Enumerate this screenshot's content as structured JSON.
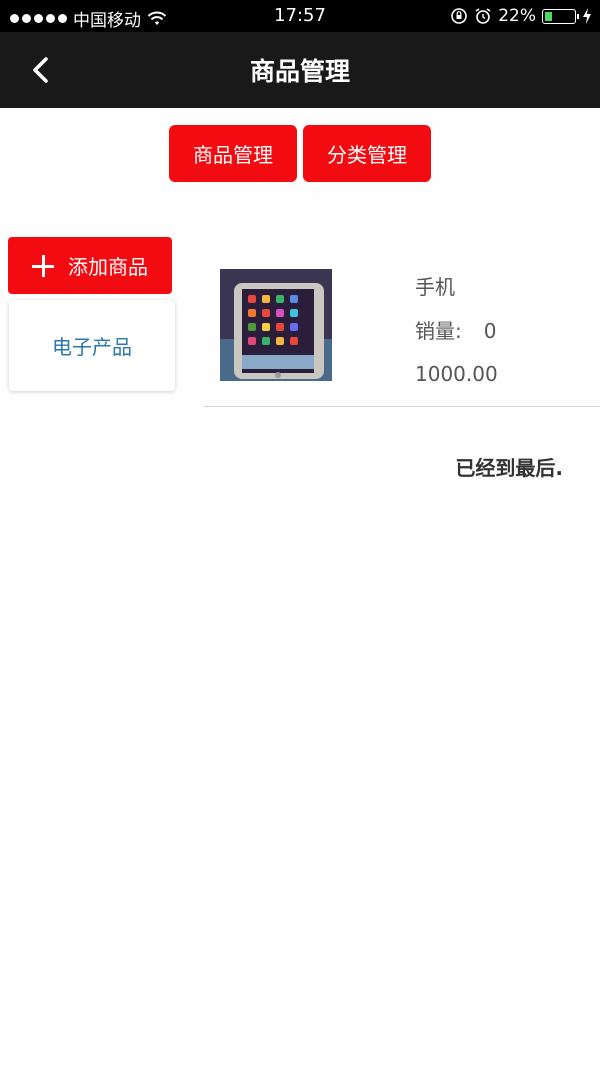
{
  "status_bar": {
    "carrier": "中国移动",
    "time": "17:57",
    "battery_percent": "22%",
    "battery_level": 0.22
  },
  "nav": {
    "title": "商品管理"
  },
  "tabs": [
    {
      "label": "商品管理"
    },
    {
      "label": "分类管理"
    }
  ],
  "sidebar": {
    "add_button_label": "添加商品",
    "categories": [
      {
        "label": "电子产品"
      }
    ]
  },
  "products": [
    {
      "name": "手机",
      "sales_label": "销量:",
      "sales_value": "0",
      "price": "1000.00"
    }
  ],
  "footer_text": "已经到最后.",
  "colors": {
    "accent_red": "#f20b11",
    "navbar_bg": "#191919",
    "category_text": "#2a78a8"
  }
}
